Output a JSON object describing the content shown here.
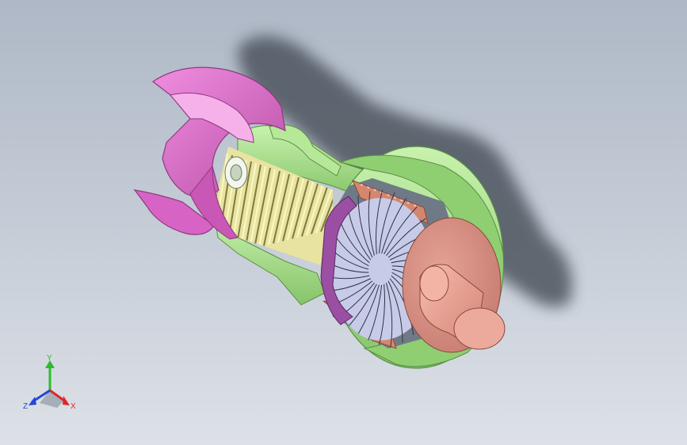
{
  "viewport": {
    "background_top": "#aeb8c6",
    "background_bottom": "#dde1e7"
  },
  "model": {
    "parts": [
      {
        "name": "intake-cowl",
        "color": "#e07ad0"
      },
      {
        "name": "compressor-casing",
        "color": "#a9e08a"
      },
      {
        "name": "compressor-blades",
        "color": "#f4f2a8"
      },
      {
        "name": "turbine-housing",
        "color": "#a9e08a"
      },
      {
        "name": "combustor-liner",
        "color": "#d4866f"
      },
      {
        "name": "turbine-blades",
        "color": "#d5d8f4"
      },
      {
        "name": "exhaust-cone",
        "color": "#e2948a"
      },
      {
        "name": "nozzle-core",
        "color": "#eea89b"
      }
    ],
    "shadow_color": "#4e555e"
  },
  "triad": {
    "x_label": "X",
    "y_label": "Y",
    "z_label": "Z",
    "x_color": "#e0262a",
    "y_color": "#2dbb2d",
    "z_color": "#2446d8"
  }
}
